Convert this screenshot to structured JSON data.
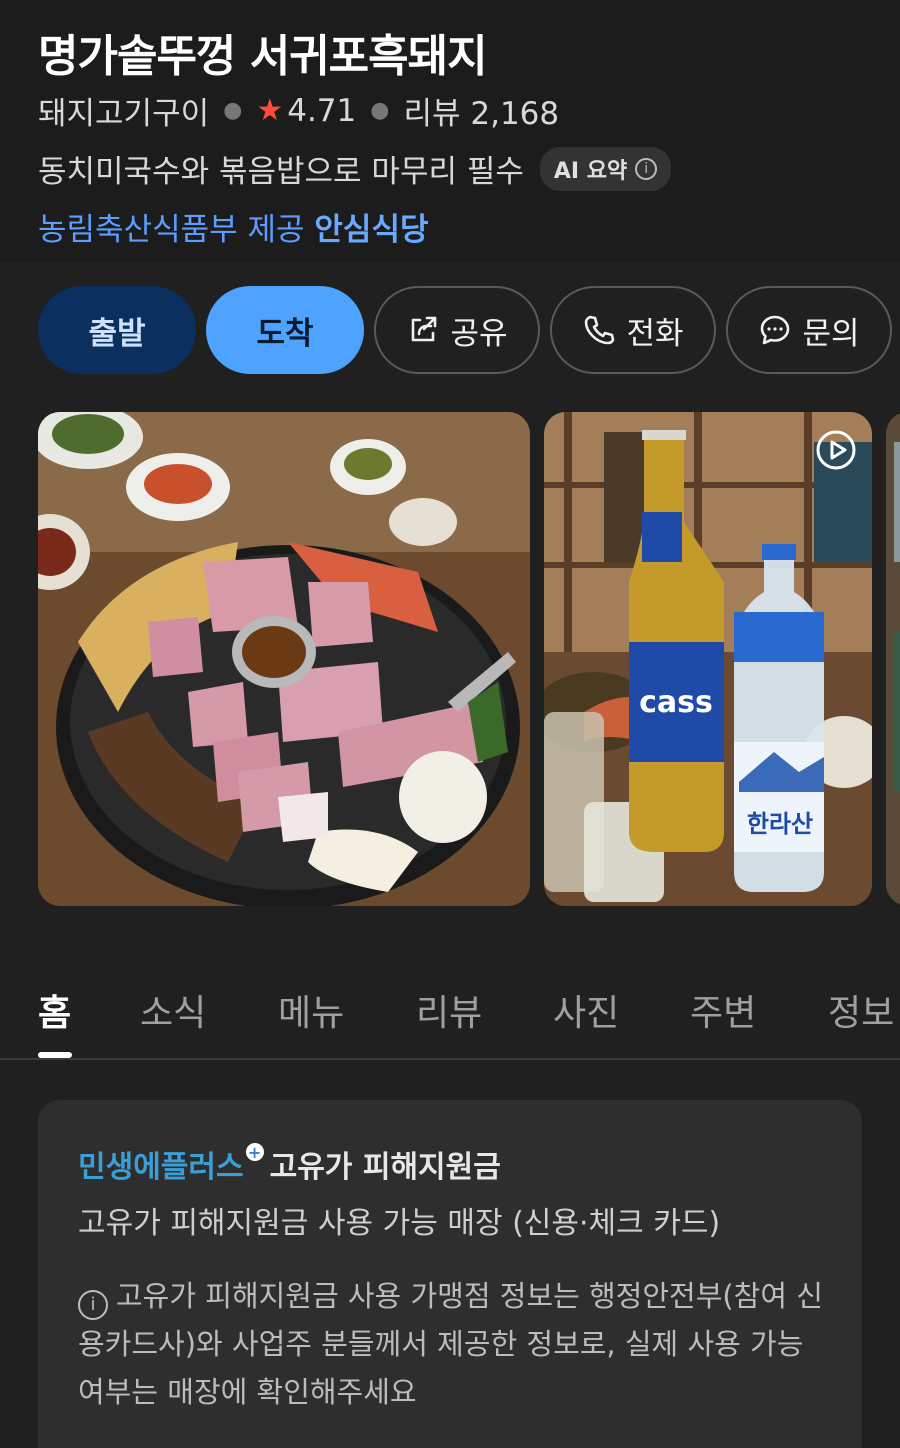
{
  "place": {
    "name": "명가솥뚜껑 서귀포흑돼지",
    "category": "돼지고기구이",
    "rating": "4.71",
    "reviews": "리뷰 2,168",
    "summary": "동치미국수와 볶음밥으로 마무리 필수",
    "ai_badge": "AI 요약",
    "cert_prefix": "농림축산식품부 제공",
    "cert_name": "안심식당"
  },
  "actions": {
    "depart": "출발",
    "arrive": "도착",
    "share": "공유",
    "call": "전화",
    "inquiry": "문의"
  },
  "tabs": [
    "홈",
    "소식",
    "메뉴",
    "리뷰",
    "사진",
    "주변",
    "정보"
  ],
  "card": {
    "brand": "민생에플러스",
    "title": "고유가 피해지원금",
    "subtitle": "고유가 피해지원금 사용 가능 매장 (신용·체크 카드)",
    "note": "고유가 피해지원금 사용 가맹점 정보는 행정안전부(참여 신용카드사)와 사업주 분들께서 제공한 정보로, 실제 사용 가능 여부는 매장에 확인해주세요"
  },
  "colors": {
    "accent": "#4da3ff",
    "depart_bg": "#0b2f5e",
    "star": "#ff4a3d",
    "cert": "#5c9dff",
    "brand": "#3b9fd6"
  },
  "icons": [
    "star-icon",
    "info-icon",
    "share-icon",
    "phone-icon",
    "chat-icon",
    "video-play-icon"
  ]
}
